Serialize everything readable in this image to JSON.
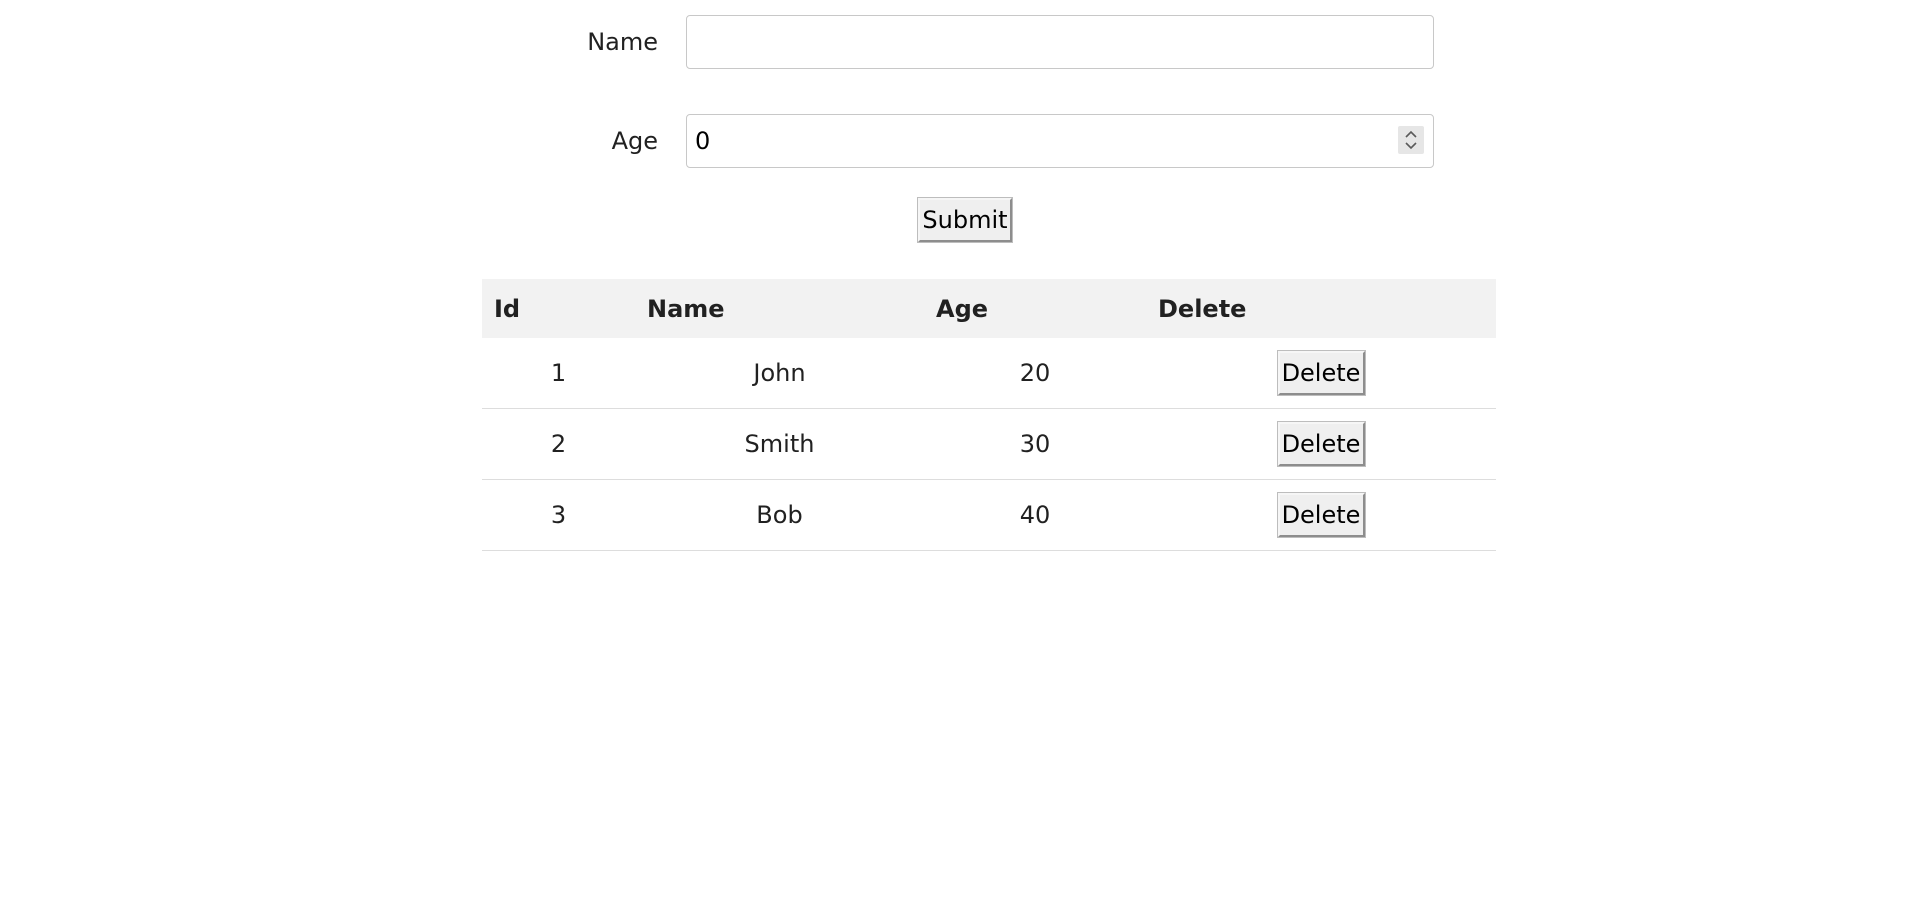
{
  "form": {
    "name": {
      "label": "Name",
      "value": "",
      "placeholder": ""
    },
    "age": {
      "label": "Age",
      "value": "0"
    },
    "submit_label": "Submit"
  },
  "table": {
    "columns": [
      "Id",
      "Name",
      "Age",
      "Delete"
    ],
    "rows": [
      {
        "id": "1",
        "name": "John",
        "age": "20",
        "action": "Delete"
      },
      {
        "id": "2",
        "name": "Smith",
        "age": "30",
        "action": "Delete"
      },
      {
        "id": "3",
        "name": "Bob",
        "age": "40",
        "action": "Delete"
      }
    ]
  }
}
